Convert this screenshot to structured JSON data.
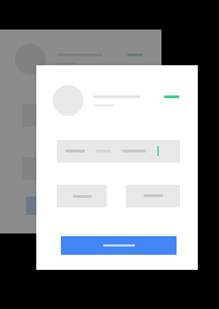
{
  "theme": {
    "background": "#000000",
    "card": "#ffffff",
    "accent_green": "#3ecf8e",
    "primary_blue": "#4285f4",
    "placeholder_gray": "#e8e8e8"
  },
  "back_card": {
    "avatar_icon": "user-avatar-placeholder",
    "status_color": "#bfead6",
    "button_color": "#c9daf8"
  },
  "front_card": {
    "avatar_icon": "user-avatar-placeholder",
    "status_color": "#3ecf8e",
    "input_caret_color": "#3ecf8e",
    "primary_button_color": "#4285f4"
  }
}
